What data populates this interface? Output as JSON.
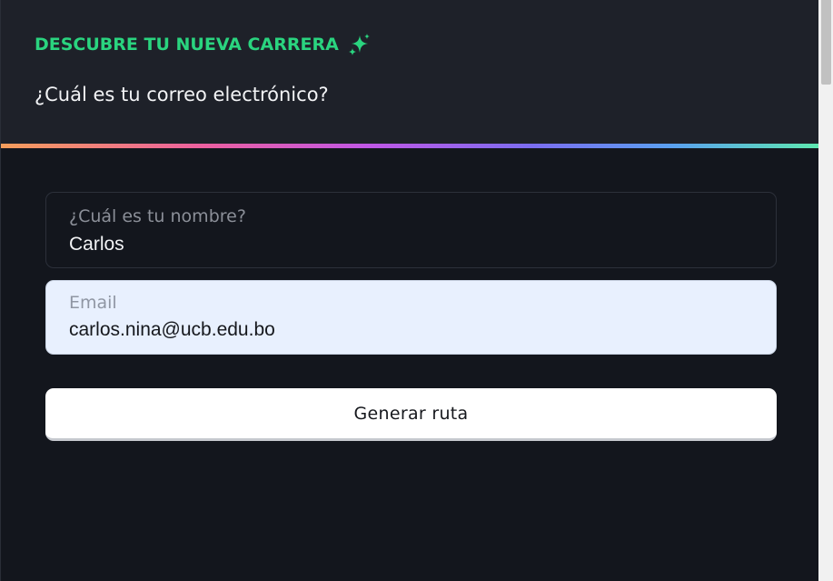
{
  "header": {
    "eyebrow": "DESCUBRE TU NUEVA CARRERA",
    "eyebrow_icon": "sparkles-icon",
    "question": "¿Cuál es tu correo electrónico?"
  },
  "form": {
    "name_field": {
      "label": "¿Cuál es tu nombre?",
      "value": "Carlos"
    },
    "email_field": {
      "label": "Email",
      "value": "carlos.nina@ucb.edu.bo"
    },
    "submit_label": "Generar ruta"
  },
  "colors": {
    "accent": "#2ad47f",
    "background": "#13161d",
    "header_background": "#1e2129",
    "autofill_background": "#e8f0fe"
  }
}
